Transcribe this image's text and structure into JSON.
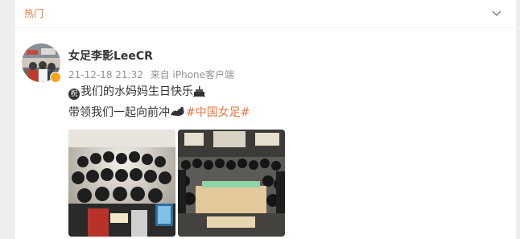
{
  "feed": {
    "tab_label": "热门"
  },
  "post": {
    "username": "女足李影LeeCR",
    "timestamp": "21-12-18 21:32",
    "source": "来自 iPhone客户端",
    "line1": {
      "emoji_char": "祝",
      "text": "我们的水妈妈生日快乐"
    },
    "line2": {
      "text": "带领我们一起向前冲",
      "hashtag": "#中国女足#"
    },
    "photos": [
      {
        "icon": "team-birthday-photo-1"
      },
      {
        "icon": "team-birthday-photo-2"
      }
    ]
  },
  "colors": {
    "accent": "#eb7340",
    "text": "#333333",
    "meta": "#939393",
    "background": "#eeeeee"
  }
}
